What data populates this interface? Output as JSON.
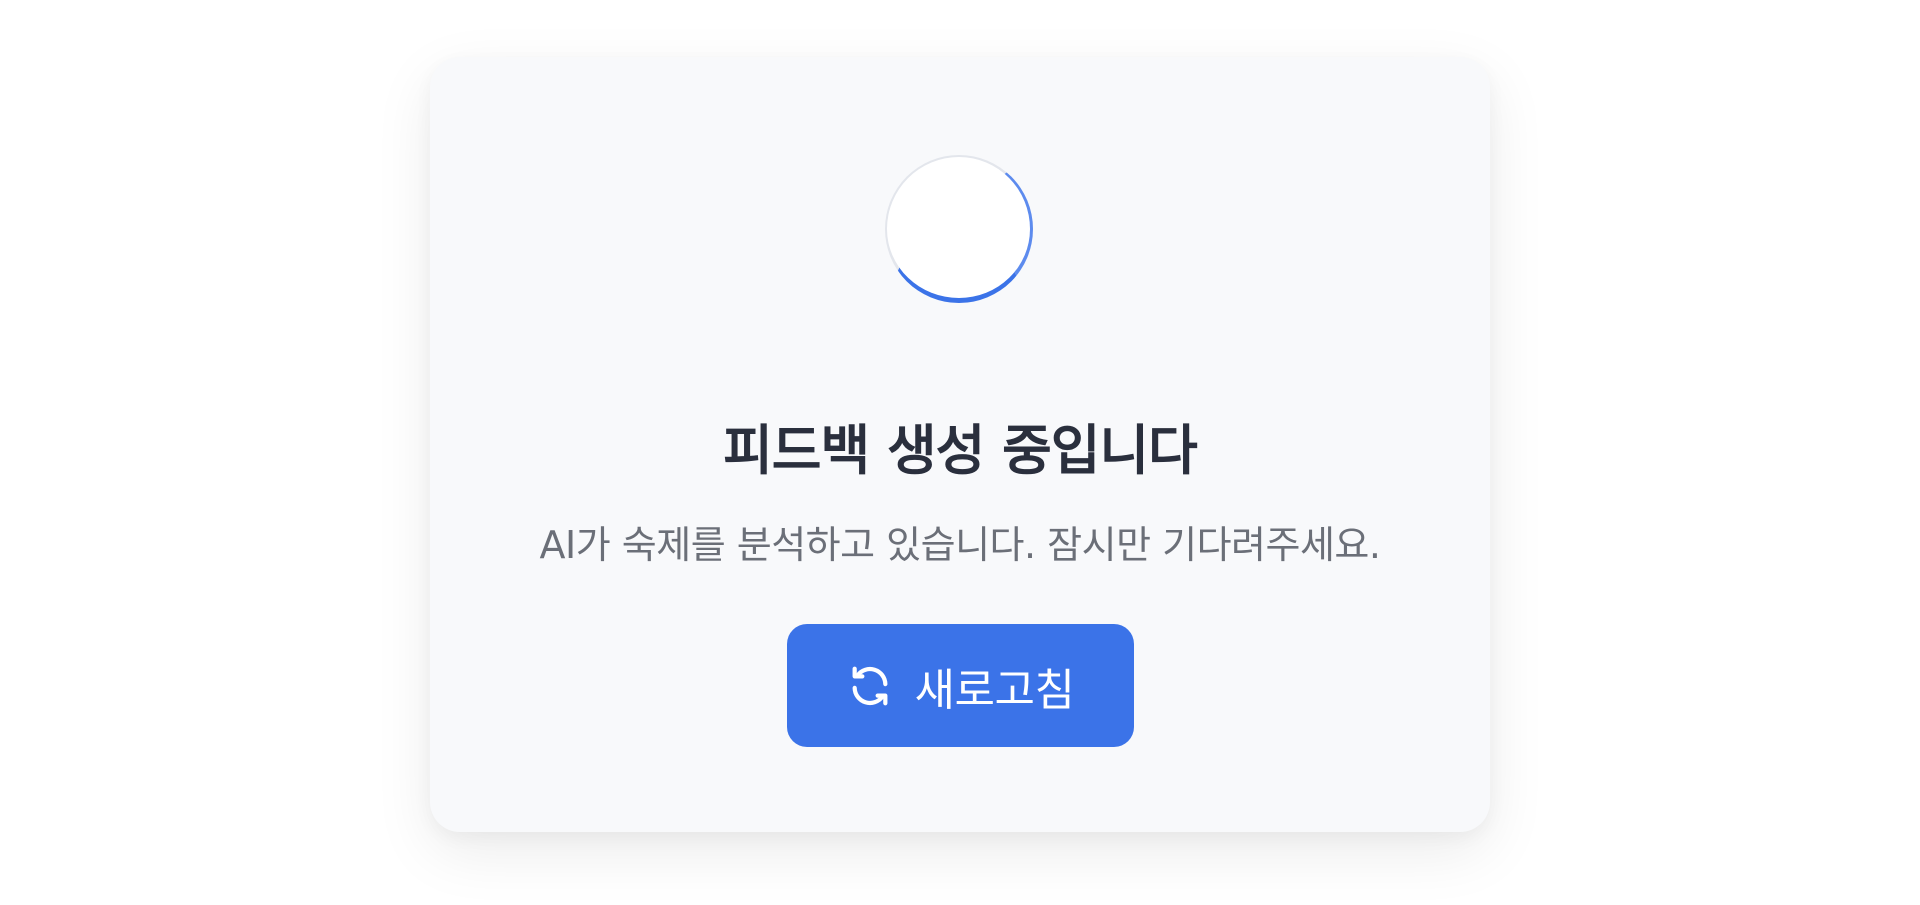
{
  "card": {
    "title": "피드백 생성 중입니다",
    "subtitle": "AI가 숙제를 분석하고 있습니다. 잠시만 기다려주세요.",
    "refresh_button": {
      "label": "새로고침",
      "icon": "refresh-icon"
    },
    "spinner": "loading-spinner"
  },
  "colors": {
    "accent": "#3b73e8",
    "title": "#2a2f3d",
    "subtitle": "#6b6f78",
    "card_bg": "#f8f9fb"
  }
}
